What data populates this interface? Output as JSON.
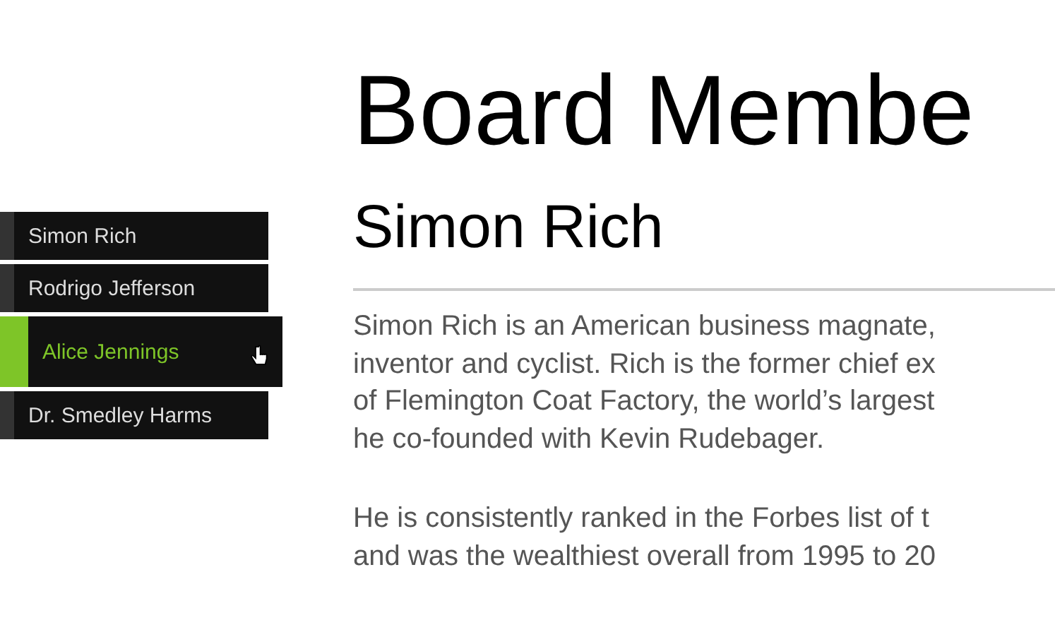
{
  "nav": {
    "items": [
      {
        "label": "Simon Rich",
        "selected": false
      },
      {
        "label": "Rodrigo Jefferson",
        "selected": false
      },
      {
        "label": "Alice Jennings",
        "selected": true
      },
      {
        "label": "Dr. Smedley Harms",
        "selected": false
      }
    ]
  },
  "page_title": "Board Membe",
  "member_name": "Simon Rich",
  "paragraphs": [
    [
      "Simon Rich is an American business magnate,",
      "inventor and cyclist. Rich is the former chief ex",
      "of Flemington Coat Factory, the world’s largest",
      "he co-founded with Kevin Rudebager."
    ],
    [
      "He is consistently ranked in the Forbes list of t",
      "and was the wealthiest overall from 1995 to 20"
    ]
  ]
}
